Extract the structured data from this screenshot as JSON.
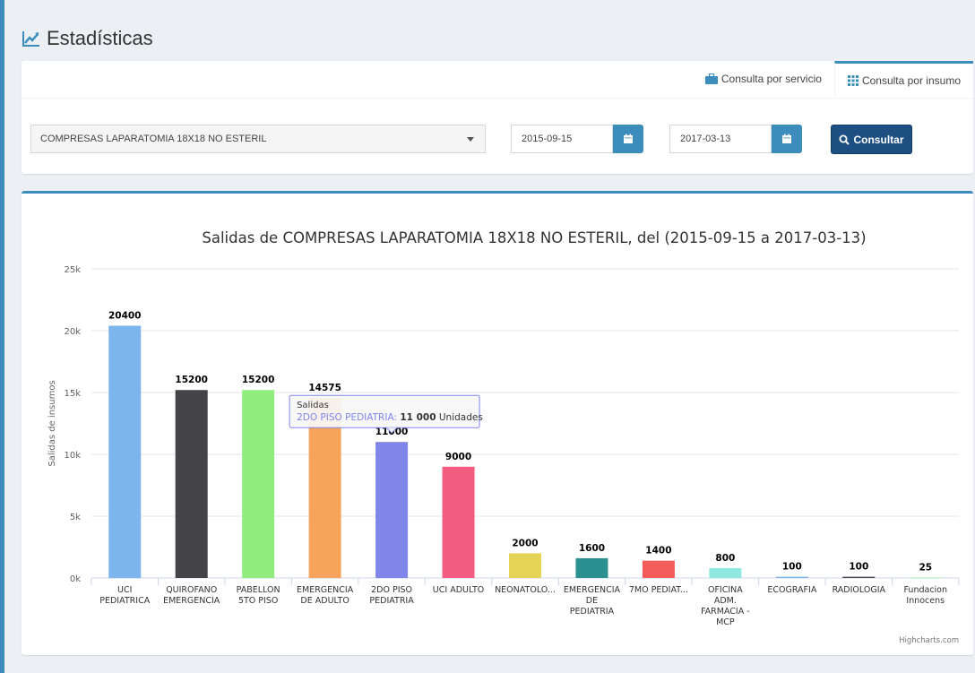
{
  "header": {
    "title": "Estadísticas",
    "icon": "line-chart-icon"
  },
  "tabs": [
    {
      "label": "Consulta por servicio",
      "icon": "briefcase-icon",
      "active": false
    },
    {
      "label": "Consulta por insumo",
      "icon": "grid-icon",
      "active": true
    }
  ],
  "form": {
    "select_value": "COMPRESAS LAPARATOMIA 18X18 NO ESTERIL",
    "date_from": "2015-09-15",
    "date_to": "2017-03-13",
    "consultar_label": "Consultar"
  },
  "colors": {
    "accent": "#3c8dbc",
    "button": "#1e4f82"
  },
  "tooltip": {
    "series": "Salidas",
    "category": "2DO PISO PEDIATRIA",
    "value_text": "11 000",
    "unit": "Unidades"
  },
  "credit": "Highcharts.com",
  "chart_data": {
    "type": "bar",
    "title": "Salidas de COMPRESAS LAPARATOMIA 18X18 NO ESTERIL, del (2015-09-15 a 2017-03-13)",
    "ylabel": "Salidas de insumos",
    "xlabel": "",
    "ylim": [
      0,
      25000
    ],
    "yticks": [
      "0k",
      "5k",
      "10k",
      "15k",
      "20k",
      "25k"
    ],
    "grid": true,
    "legend": "none",
    "categories": [
      [
        "UCI",
        "PEDIATRICA"
      ],
      [
        "QUIROFANO",
        "EMERGENCIA"
      ],
      [
        "PABELLON",
        "5TO PISO"
      ],
      [
        "EMERGENCIA",
        "DE ADULTO"
      ],
      [
        "2DO PISO",
        "PEDIATRIA"
      ],
      [
        "UCI ADULTO"
      ],
      [
        "NEONATOLO..."
      ],
      [
        "EMERGENCIA",
        "DE",
        "PEDIATRIA"
      ],
      [
        "7MO PEDIAT..."
      ],
      [
        "OFICINA",
        "ADM.",
        "FARMACIA -",
        "MCP"
      ],
      [
        "ECOGRAFIA"
      ],
      [
        "RADIOLOGIA"
      ],
      [
        "Fundacion",
        "Innocens"
      ]
    ],
    "values": [
      20400,
      15200,
      15200,
      14575,
      11000,
      9000,
      2000,
      1600,
      1400,
      800,
      100,
      100,
      25
    ],
    "colors": [
      "#7cb5ec",
      "#434348",
      "#90ed7d",
      "#f7a35c",
      "#8085e9",
      "#f15c80",
      "#e4d354",
      "#2b908f",
      "#f45b5b",
      "#91e8e1",
      "#7cb5ec",
      "#434348",
      "#90ed7d"
    ],
    "highlighted_index": 4
  }
}
